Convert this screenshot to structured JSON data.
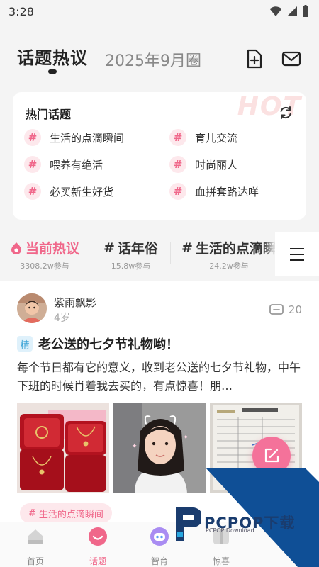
{
  "status": {
    "time": "3:28"
  },
  "header": {
    "active_tab": "话题热议",
    "secondary_tab": "2025年9月圈",
    "icons": [
      "add-document-icon",
      "mail-icon"
    ]
  },
  "hot_topics": {
    "title": "热门话题",
    "watermark": "HOT",
    "items": [
      {
        "symbol": "#",
        "label": "生活的点滴瞬间"
      },
      {
        "symbol": "#",
        "label": "育儿交流"
      },
      {
        "symbol": "#",
        "label": "喂养有绝活"
      },
      {
        "symbol": "#",
        "label": "时尚丽人"
      },
      {
        "symbol": "#",
        "label": "必买新生好货"
      },
      {
        "symbol": "#",
        "label": "血拼套路达咩"
      }
    ]
  },
  "categories": [
    {
      "name": "当前热议",
      "count": "3308.2w参与"
    },
    {
      "name": "话年俗",
      "symbol": "#",
      "count": "15.8w参与"
    },
    {
      "name": "生活的点滴瞬",
      "symbol": "#",
      "count": "24.2w参与"
    }
  ],
  "post": {
    "author": "紫雨飘影",
    "author_sub": "4岁",
    "comment_count": "20",
    "badge": "精",
    "title": "老公送的七夕节礼物哟！",
    "body": "每个节日都有它的意义，收到老公送的七夕节礼物，中午下班的时候肖着我去买的，有点惊喜！朋…",
    "tag_symbol": "#",
    "tag": "生活的点滴瞬间"
  },
  "tabbar": [
    {
      "label": "首页"
    },
    {
      "label": "话题"
    },
    {
      "label": "智育"
    },
    {
      "label": "惊喜"
    }
  ],
  "watermark": {
    "brand": "PCPOP下载",
    "sub": "PCPOP Download"
  },
  "colors": {
    "accent": "#f0678a",
    "hash_bg": "#fde8ec",
    "badge_bg": "#dff1fb",
    "badge_text": "#3aa3d6"
  }
}
